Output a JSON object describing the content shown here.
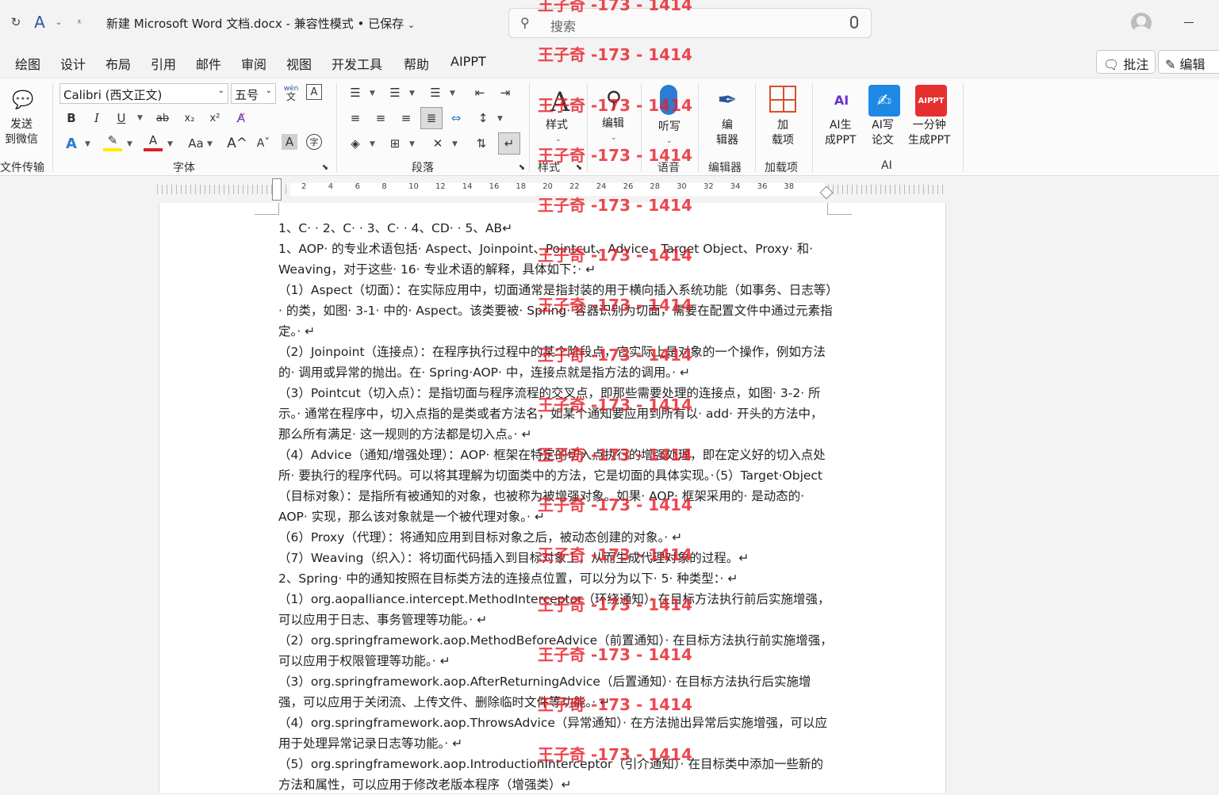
{
  "window": {
    "title": "新建 Microsoft Word 文档.docx",
    "status": "兼容性模式 • 已保存",
    "search_placeholder": "搜索"
  },
  "menu": [
    "绘图",
    "设计",
    "布局",
    "引用",
    "邮件",
    "审阅",
    "视图",
    "开发工具",
    "帮助",
    "AIPPT"
  ],
  "right_buttons": {
    "comment": "批注",
    "edit": "编辑"
  },
  "ribbon": {
    "send": {
      "label1": "发送",
      "label2": "到微信",
      "group": "文件传输"
    },
    "font": {
      "name": "Calibri (西文正文)",
      "size": "五号",
      "group": "字体",
      "phonetic": "wén",
      "phonetic2": "文"
    },
    "paragraph": {
      "group": "段落"
    },
    "styles": {
      "label": "样式",
      "group": "样式"
    },
    "editing": {
      "label": "编辑"
    },
    "dictate": {
      "label": "听写",
      "group": "语音"
    },
    "editor": {
      "label1": "编",
      "label2": "辑器",
      "group": "编辑器"
    },
    "addins": {
      "label1": "加",
      "label2": "载项",
      "group": "加载项"
    },
    "ai": {
      "ppt1": "AI生",
      "ppt2": "成PPT",
      "paper1": "AI写",
      "paper2": "论文",
      "onemin1": "一分钟",
      "onemin2": "生成PPT",
      "logo_text": "AIPPT",
      "group": "AI"
    }
  },
  "ruler_numbers": [
    "2",
    "4",
    "6",
    "8",
    "10",
    "12",
    "14",
    "16",
    "18",
    "20",
    "22",
    "24",
    "26",
    "28",
    "30",
    "32",
    "34",
    "36",
    "38"
  ],
  "watermark": "王子奇 -173 - 1414",
  "document": [
    "1、C· · 2、C· · 3、C· · 4、CD· · 5、AB↵",
    "1、AOP· 的专业术语包括· Aspect、Joinpoint、Pointcut、Advice、Target Object、Proxy· 和· Weaving，对于这些· 16· 专业术语的解释，具体如下：· ↵",
    "（1）Aspect（切面）：在实际应用中，切面通常是指封装的用于横向插入系统功能（如事务、日志等）· 的类，如图· 3-1· 中的· Aspect。该类要被· Spring· 容器识别为切面，需要在配置文件中通过元素指定。· ↵",
    "（2）Joinpoint（连接点）：在程序执行过程中的某个阶段点，它实际上是对象的一个操作，例如方法的· 调用或异常的抛出。在· Spring·AOP· 中，连接点就是指方法的调用。· ↵",
    "（3）Pointcut（切入点）：是指切面与程序流程的交叉点，即那些需要处理的连接点，如图· 3-2· 所示。· 通常在程序中，切入点指的是类或者方法名，如某个通知要应用到所有以· add· 开头的方法中，那么所有满足· 这一规则的方法都是切入点。· ↵",
    "（4）Advice（通知/增强处理）：AOP· 框架在特定的切入点执行的增强处理，即在定义好的切入点处所· 要执行的程序代码。可以将其理解为切面类中的方法，它是切面的具体实现。·（5）Target·Object（目标对象）：是指所有被通知的对象，也被称为被增强对象。如果· AOP· 框架采用的· 是动态的· AOP· 实现，那么该对象就是一个被代理对象。· ↵",
    "（6）Proxy（代理）：将通知应用到目标对象之后，被动态创建的对象。· ↵",
    "（7）Weaving（织入）：将切面代码插入到目标对象上，从而生成代理对象的过程。↵",
    "2、Spring· 中的通知按照在目标类方法的连接点位置，可以分为以下· 5· 种类型：· ↵",
    "（1）org.aopalliance.intercept.MethodInterceptor（环绕通知）· 在目标方法执行前后实施增强，可以应用于日志、事务管理等功能。· ↵",
    "（2）org.springframework.aop.MethodBeforeAdvice（前置通知）· 在目标方法执行前实施增强，可以应用于权限管理等功能。· ↵",
    "（3）org.springframework.aop.AfterReturningAdvice（后置通知）· 在目标方法执行后实施增强，可以应用于关闭流、上传文件、删除临时文件等功能。· ↵",
    "（4）org.springframework.aop.ThrowsAdvice（异常通知）· 在方法抛出异常后实施增强，可以应用于处理异常记录日志等功能。· ↵",
    "（5）org.springframework.aop.IntroductionInterceptor（引介通知）· 在目标类中添加一些新的方法和属性，可以应用于修改老版本程序（增强类）↵"
  ]
}
